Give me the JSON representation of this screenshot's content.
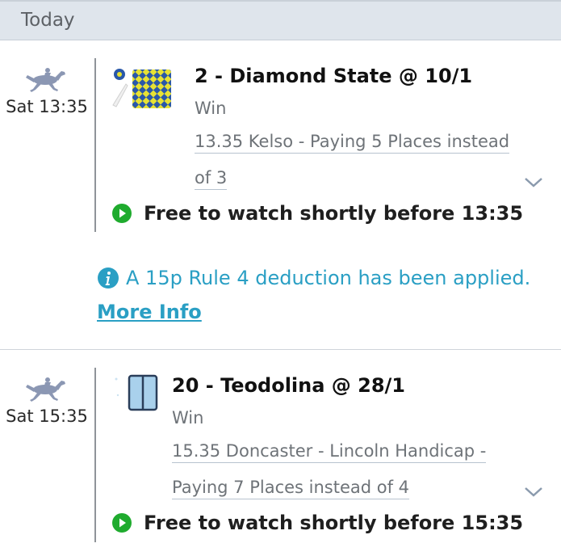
{
  "section": {
    "title": "Today"
  },
  "bets": [
    {
      "race_time": "Sat 13:35",
      "selection": "2 - Diamond State @ 10/1",
      "market": "Win",
      "event_line1": "13.35 Kelso - Paying 5 Places instead",
      "event_line2": "of 3",
      "watch": "Free to watch shortly before 13:35",
      "silk_icon": "jockey-silk-yellow-blue-diamonds-icon",
      "rule4": {
        "text": "A 15p Rule 4 deduction has been applied.",
        "link": "More Info"
      }
    },
    {
      "race_time": "Sat 15:35",
      "selection": "20 - Teodolina @ 28/1",
      "market": "Win",
      "event_line1": "15.35 Doncaster - Lincoln Handicap -",
      "event_line2": "Paying 7 Places instead of 4",
      "watch": "Free to watch shortly before 15:35",
      "silk_icon": "jockey-silk-light-blue-icon"
    }
  ],
  "colors": {
    "header_bg": "#dfe5ec",
    "accent_blue": "#2a9fc4",
    "play_green": "#1fab2e",
    "horse_icon": "#8b97b3"
  }
}
